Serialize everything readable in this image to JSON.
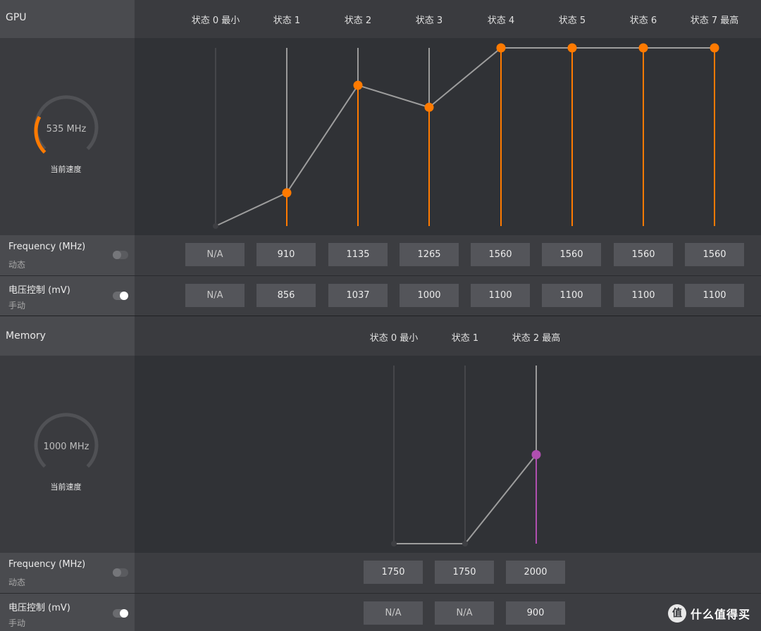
{
  "gpu": {
    "title": "GPU",
    "states": [
      "状态 0 最小",
      "状态 1",
      "状态 2",
      "状态 3",
      "状态 4",
      "状态 5",
      "状态 6",
      "状态 7 最高"
    ],
    "gauge": {
      "value_text": "535 MHz",
      "caption": "当前速度",
      "level_fraction": 0.27,
      "accent": "#ff7a00"
    },
    "curve": {
      "color": "#ff7a00",
      "active_states": [
        false,
        true,
        true,
        true,
        true,
        true,
        true,
        true
      ],
      "min": 800,
      "max": 1100,
      "points": [
        800,
        856,
        1037,
        1000,
        1100,
        1100,
        1100,
        1100
      ]
    },
    "frequency": {
      "title": "Frequency (MHz)",
      "mode": "动态",
      "toggle_on": false,
      "values": [
        "N/A",
        "910",
        "1135",
        "1265",
        "1560",
        "1560",
        "1560",
        "1560"
      ]
    },
    "voltage": {
      "title": "电压控制 (mV)",
      "mode": "手动",
      "toggle_on": true,
      "values": [
        "N/A",
        "856",
        "1037",
        "1000",
        "1100",
        "1100",
        "1100",
        "1100"
      ]
    }
  },
  "memory": {
    "title": "Memory",
    "states": [
      "状态 0 最小",
      "状态 1",
      "状态 2 最高"
    ],
    "gauge": {
      "value_text": "1000 MHz",
      "caption": "当前速度",
      "level_fraction": 0,
      "accent": "#b04fb0"
    },
    "curve": {
      "color": "#b04fb0",
      "active_states": [
        false,
        false,
        true
      ],
      "min": 1750,
      "max": 2250,
      "points": [
        1750,
        1750,
        2000
      ]
    },
    "frequency": {
      "title": "Frequency (MHz)",
      "mode": "动态",
      "toggle_on": false,
      "values": [
        "1750",
        "1750",
        "2000"
      ]
    },
    "voltage": {
      "title": "电压控制 (mV)",
      "mode": "手动",
      "toggle_on": true,
      "values": [
        "N/A",
        "N/A",
        "900"
      ]
    }
  },
  "watermark": {
    "text": "什么值得买"
  }
}
